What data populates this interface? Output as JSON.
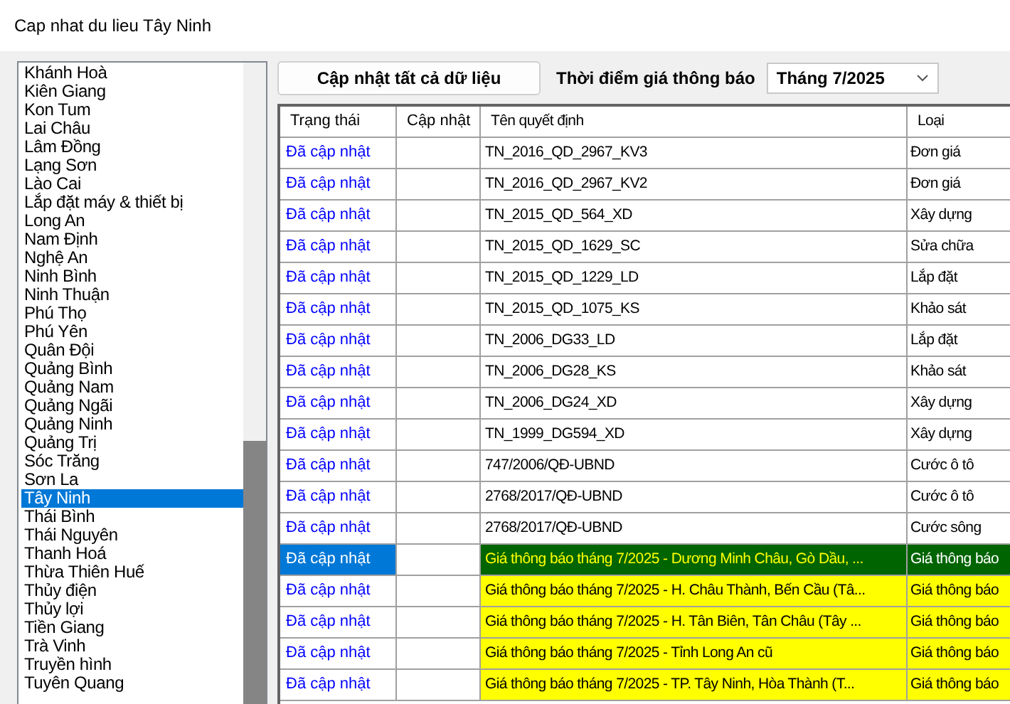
{
  "window": {
    "title": "Cap nhat du lieu Tây Ninh"
  },
  "sidebar": {
    "items": [
      {
        "label": "Khánh Hoà",
        "selected": false
      },
      {
        "label": "Kiên Giang",
        "selected": false
      },
      {
        "label": "Kon Tum",
        "selected": false
      },
      {
        "label": "Lai Châu",
        "selected": false
      },
      {
        "label": "Lâm Đồng",
        "selected": false
      },
      {
        "label": "Lạng Sơn",
        "selected": false
      },
      {
        "label": "Lào Cai",
        "selected": false
      },
      {
        "label": "Lắp đặt máy & thiết bị",
        "selected": false
      },
      {
        "label": "Long An",
        "selected": false
      },
      {
        "label": "Nam Định",
        "selected": false
      },
      {
        "label": "Nghệ An",
        "selected": false
      },
      {
        "label": "Ninh Bình",
        "selected": false
      },
      {
        "label": "Ninh Thuận",
        "selected": false
      },
      {
        "label": "Phú Thọ",
        "selected": false
      },
      {
        "label": "Phú Yên",
        "selected": false
      },
      {
        "label": "Quân Đội",
        "selected": false
      },
      {
        "label": "Quảng Bình",
        "selected": false
      },
      {
        "label": "Quảng Nam",
        "selected": false
      },
      {
        "label": "Quảng Ngãi",
        "selected": false
      },
      {
        "label": "Quảng Ninh",
        "selected": false
      },
      {
        "label": "Quảng Trị",
        "selected": false
      },
      {
        "label": "Sóc Trăng",
        "selected": false
      },
      {
        "label": "Sơn La",
        "selected": false
      },
      {
        "label": "Tây Ninh",
        "selected": true
      },
      {
        "label": "Thái Bình",
        "selected": false
      },
      {
        "label": "Thái Nguyên",
        "selected": false
      },
      {
        "label": "Thanh Hoá",
        "selected": false
      },
      {
        "label": "Thừa Thiên Huế",
        "selected": false
      },
      {
        "label": "Thủy điện",
        "selected": false
      },
      {
        "label": "Thủy lợi",
        "selected": false
      },
      {
        "label": "Tiền Giang",
        "selected": false
      },
      {
        "label": "Trà Vinh",
        "selected": false
      },
      {
        "label": "Truyền hình",
        "selected": false
      },
      {
        "label": "Tuyên Quang",
        "selected": false
      }
    ]
  },
  "toolbar": {
    "update_all_button": "Cập nhật tất cả dữ liệu",
    "period_label": "Thời điểm giá thông báo",
    "period_value": "Tháng 7/2025"
  },
  "table": {
    "columns": [
      "Trạng thái",
      "Cập nhật",
      "Tên quyết định",
      "Loại"
    ],
    "rows": [
      {
        "status": "Đã cập nhật",
        "name": "TN_2016_QD_2967_KV3",
        "type": "Đơn giá",
        "highlighted": false,
        "selected": false
      },
      {
        "status": "Đã cập nhật",
        "name": "TN_2016_QD_2967_KV2",
        "type": "Đơn giá",
        "highlighted": false,
        "selected": false
      },
      {
        "status": "Đã cập nhật",
        "name": "TN_2015_QD_564_XD",
        "type": "Xây dựng",
        "highlighted": false,
        "selected": false
      },
      {
        "status": "Đã cập nhật",
        "name": "TN_2015_QD_1629_SC",
        "type": "Sửa chữa",
        "highlighted": false,
        "selected": false
      },
      {
        "status": "Đã cập nhật",
        "name": "TN_2015_QD_1229_LD",
        "type": "Lắp đặt",
        "highlighted": false,
        "selected": false
      },
      {
        "status": "Đã cập nhật",
        "name": "TN_2015_QD_1075_KS",
        "type": "Khảo sát",
        "highlighted": false,
        "selected": false
      },
      {
        "status": "Đã cập nhật",
        "name": "TN_2006_DG33_LD",
        "type": "Lắp đặt",
        "highlighted": false,
        "selected": false
      },
      {
        "status": "Đã cập nhật",
        "name": "TN_2006_DG28_KS",
        "type": "Khảo sát",
        "highlighted": false,
        "selected": false
      },
      {
        "status": "Đã cập nhật",
        "name": "TN_2006_DG24_XD",
        "type": "Xây dựng",
        "highlighted": false,
        "selected": false
      },
      {
        "status": "Đã cập nhật",
        "name": "TN_1999_DG594_XD",
        "type": "Xây dựng",
        "highlighted": false,
        "selected": false
      },
      {
        "status": "Đã cập nhật",
        "name": "747/2006/QĐ-UBND",
        "type": "Cước ô tô",
        "highlighted": false,
        "selected": false
      },
      {
        "status": "Đã cập nhật",
        "name": "2768/2017/QĐ-UBND",
        "type": "Cước ô tô",
        "highlighted": false,
        "selected": false
      },
      {
        "status": "Đã cập nhật",
        "name": "2768/2017/QĐ-UBND",
        "type": "Cước sông",
        "highlighted": false,
        "selected": false
      },
      {
        "status": "Đã cập nhật",
        "name": "Giá thông báo tháng 7/2025 - Dương Minh Châu, Gò Dầu, ...",
        "type": "Giá thông báo",
        "highlighted": true,
        "selected": true
      },
      {
        "status": "Đã cập nhật",
        "name": "Giá thông báo tháng 7/2025 - H. Châu Thành, Bến Cầu (Tâ...",
        "type": "Giá thông báo",
        "highlighted": true,
        "selected": false
      },
      {
        "status": "Đã cập nhật",
        "name": "Giá thông báo tháng 7/2025 - H. Tân Biên, Tân Châu (Tây ...",
        "type": "Giá thông báo",
        "highlighted": true,
        "selected": false
      },
      {
        "status": "Đã cập nhật",
        "name": "Giá thông báo tháng 7/2025 - Tỉnh Long An cũ",
        "type": "Giá thông báo",
        "highlighted": true,
        "selected": false
      },
      {
        "status": "Đã cập nhật",
        "name": "Giá thông báo tháng 7/2025 - TP. Tây Ninh, Hòa Thành (T...",
        "type": "Giá thông báo",
        "highlighted": true,
        "selected": false
      }
    ]
  }
}
